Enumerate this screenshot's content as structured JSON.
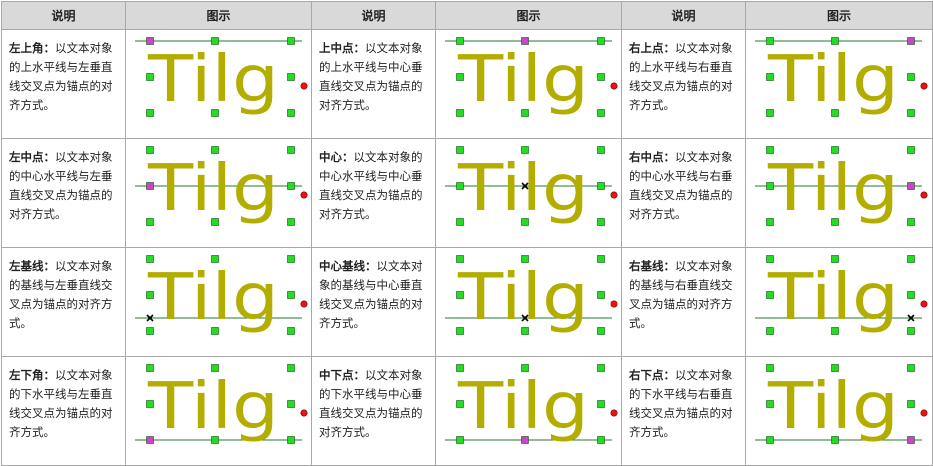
{
  "table": {
    "headers": [
      "说明",
      "图示",
      "说明",
      "图示",
      "说明",
      "图示"
    ],
    "glyph_text": "Tilg",
    "cells": [
      {
        "title": "左上角",
        "text": "以文本对象的上水平线与左垂直线交叉点为锚点的对齐方式。",
        "anchor": "top-left"
      },
      {
        "title": "上中点",
        "text": "以文本对象的上水平线与中心垂直线交叉点为锚点的对齐方式。",
        "anchor": "top-center"
      },
      {
        "title": "右上点",
        "text": "以文本对象的上水平线与右垂直线交叉点为锚点的对齐方式。",
        "anchor": "top-right"
      },
      {
        "title": "左中点",
        "text": "以文本对象的中心水平线与左垂直线交叉点为锚点的对齐方式。",
        "anchor": "middle-left"
      },
      {
        "title": "中心",
        "text": "以文本对象的中心水平线与中心垂直线交叉点为锚点的对齐方式。",
        "anchor": "center"
      },
      {
        "title": "右中点",
        "text": "以文本对象的中心水平线与右垂直线交叉点为锚点的对齐方式。",
        "anchor": "middle-right"
      },
      {
        "title": "左基线",
        "text": "以文本对象的基线与左垂直线交叉点为锚点的对齐方式。",
        "anchor": "baseline-left"
      },
      {
        "title": "中心基线",
        "text": "以文本对象的基线与中心垂直线交叉点为锚点的对齐方式。",
        "anchor": "baseline-center"
      },
      {
        "title": "右基线",
        "text": "以文本对象的基线与右垂直线交叉点为锚点的对齐方式。",
        "anchor": "baseline-right"
      },
      {
        "title": "左下角",
        "text": "以文本对象的下水平线与左垂直线交叉点为锚点的对齐方式。",
        "anchor": "bottom-left"
      },
      {
        "title": "中下点",
        "text": "以文本对象的下水平线与中心垂直线交叉点为锚点的对齐方式。",
        "anchor": "bottom-center"
      },
      {
        "title": "右下点",
        "text": "以文本对象的下水平线与右垂直线交叉点为锚点的对齐方式。",
        "anchor": "bottom-right"
      }
    ],
    "colors": {
      "header_bg": "#d9d9d9",
      "border": "#a8a8a8",
      "glyph": "#b3ad00",
      "guide_line": "#2a7a2a",
      "handle": "#22dd22",
      "anchor_handle": "#cc44cc",
      "rotation_dot": "#ee1111"
    }
  }
}
